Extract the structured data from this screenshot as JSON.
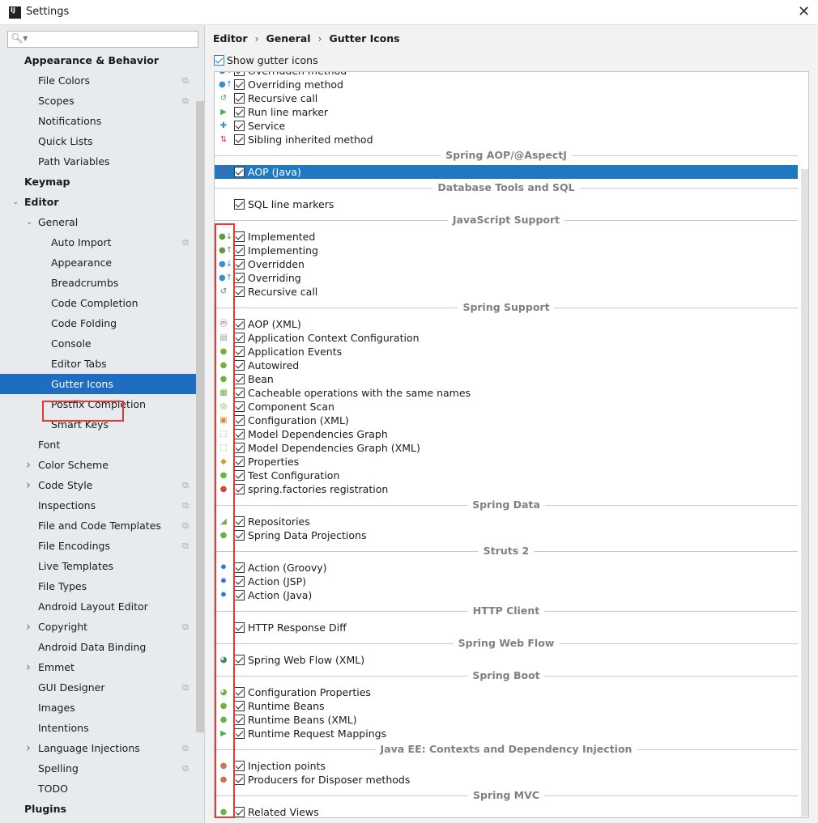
{
  "window": {
    "title": "Settings",
    "close_label": "✕"
  },
  "search": {
    "placeholder": "",
    "icon": "search-icon"
  },
  "sidebar": {
    "items": [
      {
        "label": "Appearance & Behavior",
        "level": 0,
        "bold": true
      },
      {
        "label": "File Colors",
        "level": 1,
        "copy": true
      },
      {
        "label": "Scopes",
        "level": 1,
        "copy": true
      },
      {
        "label": "Notifications",
        "level": 1
      },
      {
        "label": "Quick Lists",
        "level": 1
      },
      {
        "label": "Path Variables",
        "level": 1
      },
      {
        "label": "Keymap",
        "level": 0,
        "bold": true
      },
      {
        "label": "Editor",
        "level": 0,
        "bold": true,
        "expander": "expanded"
      },
      {
        "label": "General",
        "level": 1,
        "expander": "expanded"
      },
      {
        "label": "Auto Import",
        "level": 2,
        "copy": true
      },
      {
        "label": "Appearance",
        "level": 2
      },
      {
        "label": "Breadcrumbs",
        "level": 2
      },
      {
        "label": "Code Completion",
        "level": 2
      },
      {
        "label": "Code Folding",
        "level": 2
      },
      {
        "label": "Console",
        "level": 2
      },
      {
        "label": "Editor Tabs",
        "level": 2
      },
      {
        "label": "Gutter Icons",
        "level": 2,
        "selected": true
      },
      {
        "label": "Postfix Completion",
        "level": 2
      },
      {
        "label": "Smart Keys",
        "level": 2
      },
      {
        "label": "Font",
        "level": 1
      },
      {
        "label": "Color Scheme",
        "level": 1,
        "expander": "collapsed"
      },
      {
        "label": "Code Style",
        "level": 1,
        "expander": "collapsed",
        "copy": true
      },
      {
        "label": "Inspections",
        "level": 1,
        "copy": true
      },
      {
        "label": "File and Code Templates",
        "level": 1,
        "copy": true
      },
      {
        "label": "File Encodings",
        "level": 1,
        "copy": true
      },
      {
        "label": "Live Templates",
        "level": 1
      },
      {
        "label": "File Types",
        "level": 1
      },
      {
        "label": "Android Layout Editor",
        "level": 1
      },
      {
        "label": "Copyright",
        "level": 1,
        "expander": "collapsed",
        "copy": true
      },
      {
        "label": "Android Data Binding",
        "level": 1
      },
      {
        "label": "Emmet",
        "level": 1,
        "expander": "collapsed"
      },
      {
        "label": "GUI Designer",
        "level": 1,
        "copy": true
      },
      {
        "label": "Images",
        "level": 1
      },
      {
        "label": "Intentions",
        "level": 1
      },
      {
        "label": "Language Injections",
        "level": 1,
        "expander": "collapsed",
        "copy": true
      },
      {
        "label": "Spelling",
        "level": 1,
        "copy": true
      },
      {
        "label": "TODO",
        "level": 1
      },
      {
        "label": "Plugins",
        "level": 0,
        "bold": true
      }
    ]
  },
  "breadcrumb": [
    "Editor",
    "General",
    "Gutter Icons"
  ],
  "show_gutter_icons": {
    "label": "Show gutter icons",
    "checked": true
  },
  "colors": {
    "accent": "#1e78c2",
    "highlight_box": "#e53935"
  },
  "gutter_list": [
    {
      "label": "Overridden method",
      "icon": "overridden-method-icon",
      "checked": true
    },
    {
      "label": "Overriding method",
      "icon": "overriding-method-icon",
      "checked": true
    },
    {
      "label": "Recursive call",
      "icon": "recursive-call-icon",
      "checked": true
    },
    {
      "label": "Run line marker",
      "icon": "run-icon",
      "checked": true
    },
    {
      "label": "Service",
      "icon": "service-icon",
      "checked": true
    },
    {
      "label": "Sibling inherited method",
      "icon": "sibling-inherited-icon",
      "checked": true
    },
    {
      "header": "Spring AOP/@AspectJ"
    },
    {
      "label": "AOP (Java)",
      "icon": "aop-icon",
      "checked": true,
      "selected": true
    },
    {
      "header": "Database Tools and SQL"
    },
    {
      "label": "SQL line markers",
      "icon": "",
      "checked": true
    },
    {
      "header": "JavaScript Support"
    },
    {
      "label": "Implemented",
      "icon": "implemented-icon",
      "checked": true
    },
    {
      "label": "Implementing",
      "icon": "implementing-icon",
      "checked": true
    },
    {
      "label": "Overridden",
      "icon": "overridden-icon",
      "checked": true
    },
    {
      "label": "Overriding",
      "icon": "overriding-icon",
      "checked": true
    },
    {
      "label": "Recursive call",
      "icon": "recursive-call-icon",
      "checked": true
    },
    {
      "header": "Spring Support"
    },
    {
      "label": "AOP (XML)",
      "icon": "aop-icon",
      "checked": true
    },
    {
      "label": "Application Context Configuration",
      "icon": "context-config-icon",
      "checked": true
    },
    {
      "label": "Application Events",
      "icon": "spring-leaf-icon",
      "checked": true
    },
    {
      "label": "Autowired",
      "icon": "spring-leaf-icon",
      "checked": true
    },
    {
      "label": "Bean",
      "icon": "spring-leaf-icon",
      "checked": true
    },
    {
      "label": "Cacheable operations with the same names",
      "icon": "cacheable-icon",
      "checked": true
    },
    {
      "label": "Component Scan",
      "icon": "component-scan-icon",
      "checked": true
    },
    {
      "label": "Configuration (XML)",
      "icon": "xml-config-icon",
      "checked": true
    },
    {
      "label": "Model Dependencies Graph",
      "icon": "graph-icon",
      "checked": true
    },
    {
      "label": "Model Dependencies Graph (XML)",
      "icon": "graph-icon",
      "checked": true
    },
    {
      "label": "Properties",
      "icon": "properties-icon",
      "checked": true
    },
    {
      "label": "Test Configuration",
      "icon": "spring-leaf-icon",
      "checked": true
    },
    {
      "label": "spring.factories registration",
      "icon": "spring-factories-icon",
      "checked": true
    },
    {
      "header": "Spring Data"
    },
    {
      "label": "Repositories",
      "icon": "repositories-icon",
      "checked": true
    },
    {
      "label": "Spring Data Projections",
      "icon": "projections-icon",
      "checked": true
    },
    {
      "header": "Struts 2"
    },
    {
      "label": "Action (Groovy)",
      "icon": "gear-icon",
      "checked": true
    },
    {
      "label": "Action (JSP)",
      "icon": "gear-icon",
      "checked": true
    },
    {
      "label": "Action (Java)",
      "icon": "gear-icon",
      "checked": true
    },
    {
      "header": "HTTP Client"
    },
    {
      "label": "HTTP Response Diff",
      "icon": "",
      "checked": true
    },
    {
      "header": "Spring Web Flow"
    },
    {
      "label": "Spring Web Flow (XML)",
      "icon": "web-flow-icon",
      "checked": true
    },
    {
      "header": "Spring Boot"
    },
    {
      "label": "Configuration Properties",
      "icon": "config-properties-icon",
      "checked": true
    },
    {
      "label": "Runtime Beans",
      "icon": "spring-leaf-icon",
      "checked": true
    },
    {
      "label": "Runtime Beans (XML)",
      "icon": "spring-leaf-icon",
      "checked": true
    },
    {
      "label": "Runtime Request Mappings",
      "icon": "run-icon",
      "checked": true
    },
    {
      "header": "Java EE: Contexts and Dependency Injection"
    },
    {
      "label": "Injection points",
      "icon": "injection-icon",
      "checked": true
    },
    {
      "label": "Producers for Disposer methods",
      "icon": "injection-icon",
      "checked": true
    },
    {
      "header": "Spring MVC"
    },
    {
      "label": "Related Views",
      "icon": "spring-leaf-icon",
      "checked": true
    }
  ]
}
